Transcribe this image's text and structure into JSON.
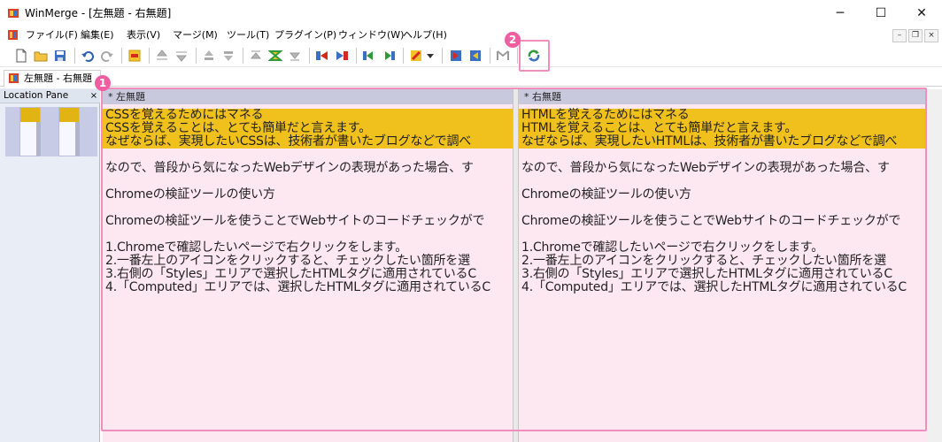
{
  "window": {
    "title": "WinMerge - [左無題 - 右無題]",
    "minimize": "─",
    "maximize": "☐",
    "close": "✕"
  },
  "menu": {
    "items": [
      "ファイル(F)",
      "編集(E)",
      "表示(V)",
      "マージ(M)",
      "ツール(T)",
      "プラグイン(P)",
      "ウィンドウ(W)",
      "ヘルプ(H)"
    ],
    "mdi_minimize": "–",
    "mdi_restore": "❐",
    "mdi_close": "×"
  },
  "toolbar": {
    "icons": [
      "new-document-icon",
      "open-folder-icon",
      "save-icon",
      "undo-icon",
      "redo-icon",
      "first-diff-icon",
      "prev-diff-icon",
      "next-diff-icon",
      "prev-conflict-icon",
      "next-conflict-icon",
      "first-conflict-icon",
      "current-diff-icon",
      "last-diff-icon",
      "copy-right-icon",
      "copy-left-icon",
      "copy-right-advance-icon",
      "copy-left-advance-icon",
      "options-icon",
      "dropdown-icon",
      "all-right-icon",
      "all-left-icon",
      "compare-icon",
      "refresh-icon"
    ]
  },
  "tab": {
    "label": "左無題 - 右無題"
  },
  "location_pane": {
    "title": "Location Pane",
    "close": "×"
  },
  "left_pane": {
    "header": "* 左無題",
    "lines": [
      {
        "text": "CSSを覚えるためにはマネる",
        "changed": true
      },
      {
        "text": "CSSを覚えることは、とても簡単だと言えます。",
        "changed": true
      },
      {
        "text": "なぜならば、実現したいCSSは、技術者が書いたブログなどで調べ",
        "changed": true
      },
      {
        "text": "",
        "changed": false
      },
      {
        "text": "なので、普段から気になったWebデザインの表現があった場合、す",
        "changed": false
      },
      {
        "text": "",
        "changed": false
      },
      {
        "text": "Chromeの検証ツールの使い方",
        "changed": false
      },
      {
        "text": "",
        "changed": false
      },
      {
        "text": "Chromeの検証ツールを使うことでWebサイトのコードチェックがで",
        "changed": false
      },
      {
        "text": "",
        "changed": false
      },
      {
        "text": "1.Chromeで確認したいページで右クリックをします。",
        "changed": false
      },
      {
        "text": "2.一番左上のアイコンをクリックすると、チェックしたい箇所を選",
        "changed": false
      },
      {
        "text": "3.右側の「Styles」エリアで選択したHTMLタグに適用されているC",
        "changed": false
      },
      {
        "text": "4.「Computed」エリアでは、選択したHTMLタグに適用されているC",
        "changed": false
      }
    ]
  },
  "right_pane": {
    "header": "* 右無題",
    "lines": [
      {
        "text": "HTMLを覚えるためにはマネる",
        "changed": true
      },
      {
        "text": "HTMLを覚えることは、とても簡単だと言えます。",
        "changed": true
      },
      {
        "text": "なぜならば、実現したいHTMLは、技術者が書いたブログなどで調べ",
        "changed": true
      },
      {
        "text": "",
        "changed": false
      },
      {
        "text": "なので、普段から気になったWebデザインの表現があった場合、す",
        "changed": false
      },
      {
        "text": "",
        "changed": false
      },
      {
        "text": "Chromeの検証ツールの使い方",
        "changed": false
      },
      {
        "text": "",
        "changed": false
      },
      {
        "text": "Chromeの検証ツールを使うことでWebサイトのコードチェックがで",
        "changed": false
      },
      {
        "text": "",
        "changed": false
      },
      {
        "text": "1.Chromeで確認したいページで右クリックをします。",
        "changed": false
      },
      {
        "text": "2.一番左上のアイコンをクリックすると、チェックしたい箇所を選",
        "changed": false
      },
      {
        "text": "3.右側の「Styles」エリアで選択したHTMLタグに適用されているC",
        "changed": false
      },
      {
        "text": "4.「Computed」エリアでは、選択したHTMLタグに適用されているC",
        "changed": false
      }
    ]
  },
  "annotations": {
    "badge1": "1",
    "badge2": "2"
  },
  "colors": {
    "changed_line": "#f0c01c",
    "highlight_border": "#f08fbe",
    "pane_bg": "#fde7f1",
    "badge": "#ef5ea0"
  }
}
